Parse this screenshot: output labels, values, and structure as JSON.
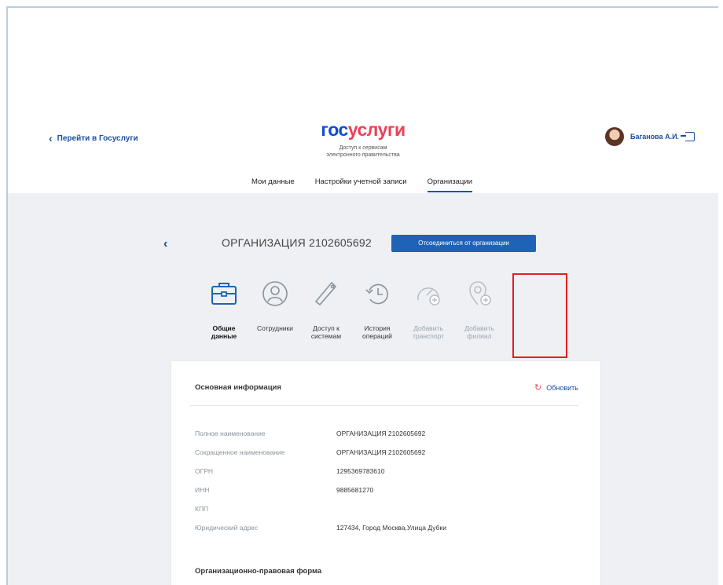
{
  "header": {
    "back_link": "Перейти в Госуслуги",
    "logo_part1": "гос",
    "logo_part2": "услуги",
    "tagline_line1": "Доступ к сервисам",
    "tagline_line2": "электронного правительства",
    "user_name": "Баганова А.И."
  },
  "nav": {
    "items": [
      "Мои данные",
      "Настройки учетной записи",
      "Организации"
    ],
    "active": "Организации"
  },
  "org": {
    "title": "ОРГАНИЗАЦИЯ 2102605692",
    "detach_button": "Отсоединиться от организации"
  },
  "tabs": [
    {
      "label": "Общие данные",
      "icon": "briefcase-icon",
      "state": "active"
    },
    {
      "label": "Сотрудники",
      "icon": "user-icon",
      "state": "normal"
    },
    {
      "label": "Доступ к системам",
      "icon": "key-icon",
      "state": "normal"
    },
    {
      "label": "История операций",
      "icon": "history-icon",
      "state": "normal"
    },
    {
      "label": "Добавить транспорт",
      "icon": "speedometer-icon",
      "state": "disabled"
    },
    {
      "label": "Добавить филиал",
      "icon": "location-add-icon",
      "state": "disabled"
    }
  ],
  "card": {
    "title": "Основная информация",
    "refresh": "Обновить",
    "rows": [
      {
        "label": "Полное наименование",
        "value": "ОРГАНИЗАЦИЯ 2102605692"
      },
      {
        "label": "Сокращенное наименование",
        "value": "ОРГАНИЗАЦИЯ 2102605692"
      },
      {
        "label": "ОГРН",
        "value": "1295369783610"
      },
      {
        "label": "ИНН",
        "value": "9885681270"
      },
      {
        "label": "КПП",
        "value": ""
      },
      {
        "label": "Юридический адрес",
        "value": "127434, Город Москва,Улица Дубки"
      }
    ],
    "section2": "Организационно-правовая форма"
  },
  "colors": {
    "brand_blue": "#0d4cd3",
    "brand_red": "#ee3f58",
    "button_blue": "#1f63b6",
    "highlight_red": "#e51c23"
  }
}
